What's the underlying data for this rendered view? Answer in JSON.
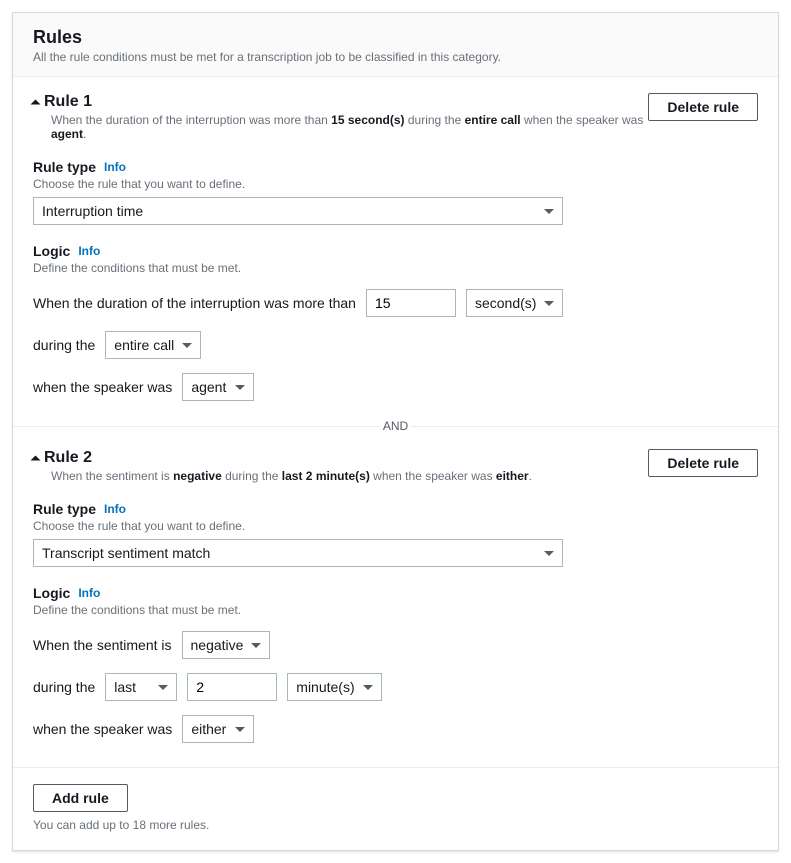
{
  "header": {
    "title": "Rules",
    "subtitle": "All the rule conditions must be met for a transcription job to be classified in this category."
  },
  "common": {
    "delete_label": "Delete rule",
    "rule_type_label": "Rule type",
    "info_label": "Info",
    "rule_type_sub": "Choose the rule that you want to define.",
    "logic_label": "Logic",
    "logic_sub": "Define the conditions that must be met.",
    "and_label": "AND"
  },
  "rule1": {
    "title": "Rule 1",
    "desc_pre": "When the duration of the interruption was more than ",
    "desc_val": "15 second(s)",
    "desc_mid": " during the ",
    "desc_scope": "entire call",
    "desc_spk_pre": " when the speaker was ",
    "desc_spk": "agent",
    "desc_end": ".",
    "rule_type_value": "Interruption time",
    "logic_text": "When the duration of the interruption was more than",
    "duration_value": "15",
    "unit_value": "second(s)",
    "during_label": "during the",
    "scope_value": "entire call",
    "speaker_label": "when the speaker was",
    "speaker_value": "agent"
  },
  "rule2": {
    "title": "Rule 2",
    "desc_pre": "When the sentiment is ",
    "desc_sent": "negative",
    "desc_mid": " during the ",
    "desc_scope": "last 2 minute(s)",
    "desc_spk_pre": " when the speaker was ",
    "desc_spk": "either",
    "desc_end": ".",
    "rule_type_value": "Transcript sentiment match",
    "logic_text": "When the sentiment is",
    "sentiment_value": "negative",
    "during_label": "during the",
    "scope_value": "last",
    "scope_num": "2",
    "scope_unit": "minute(s)",
    "speaker_label": "when the speaker was",
    "speaker_value": "either"
  },
  "footer": {
    "add_label": "Add rule",
    "hint": "You can add up to 18 more rules."
  }
}
